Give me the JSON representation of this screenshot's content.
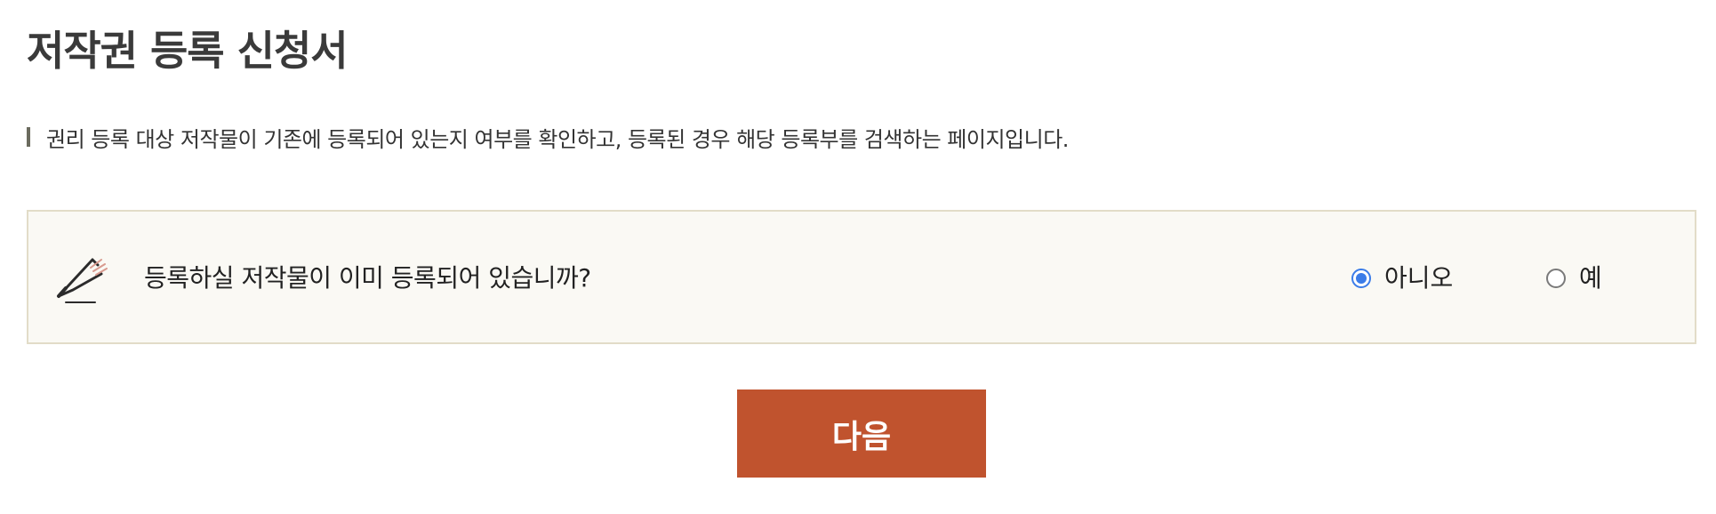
{
  "page": {
    "title": "저작권 등록 신청서",
    "description": "권리 등록 대상 저작물이 기존에 등록되어 있는지 여부를 확인하고, 등록된 경우 해당 등록부를 검색하는 페이지입니다."
  },
  "question": {
    "icon": "pen-icon",
    "text": "등록하실 저작물이 이미 등록되어 있습니까?",
    "options": [
      {
        "label": "아니오",
        "selected": true
      },
      {
        "label": "예",
        "selected": false
      }
    ]
  },
  "actions": {
    "next_label": "다음",
    "next_color": "#c0532e"
  },
  "colors": {
    "radio_selected": "#3b7ce8",
    "box_background": "#faf9f4",
    "box_border": "#e2dcc8"
  }
}
